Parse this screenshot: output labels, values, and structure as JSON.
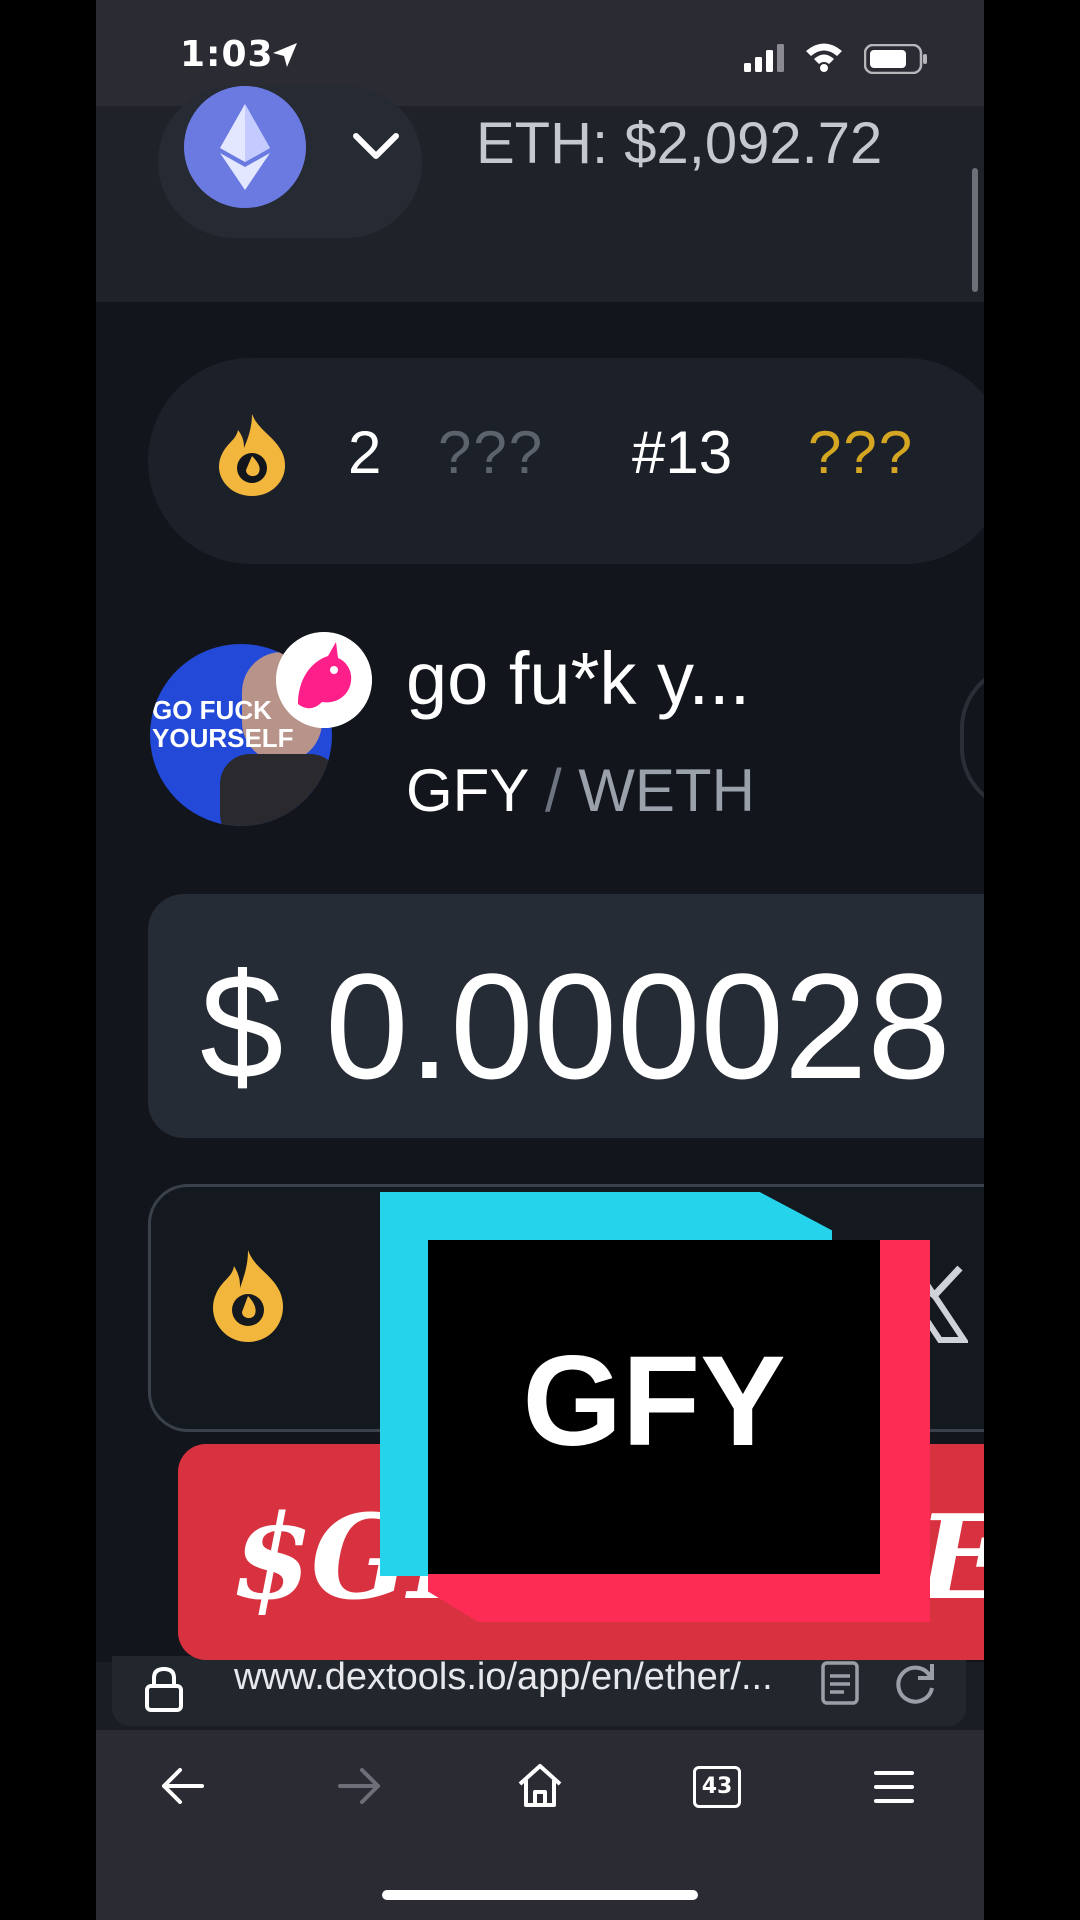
{
  "status_bar": {
    "time": "1:03"
  },
  "header": {
    "eth_price": "ETH: $2,092.72"
  },
  "hot_pairs": {
    "rank": "2",
    "placeholder_a": "???",
    "pair_rank": "#13",
    "placeholder_b": "???"
  },
  "token": {
    "avatar_text": "GO FUCK YOURSELF",
    "name": "go fu*k y...",
    "base": "GFY",
    "separator": "/",
    "quote": "WETH",
    "price": "$ 0.000028"
  },
  "overlay": {
    "banner_left": "$GI",
    "banner_right": "E!",
    "logo_text": "GFY"
  },
  "browser": {
    "url": "www.dextools.io/app/en/ether/...",
    "tab_count": "43"
  },
  "colors": {
    "accent_gold": "#d4a622",
    "banner_red": "#d8313f",
    "tt_cyan": "#25d3ea",
    "tt_red": "#fc2c55",
    "eth_blue": "#6a7ae0"
  }
}
